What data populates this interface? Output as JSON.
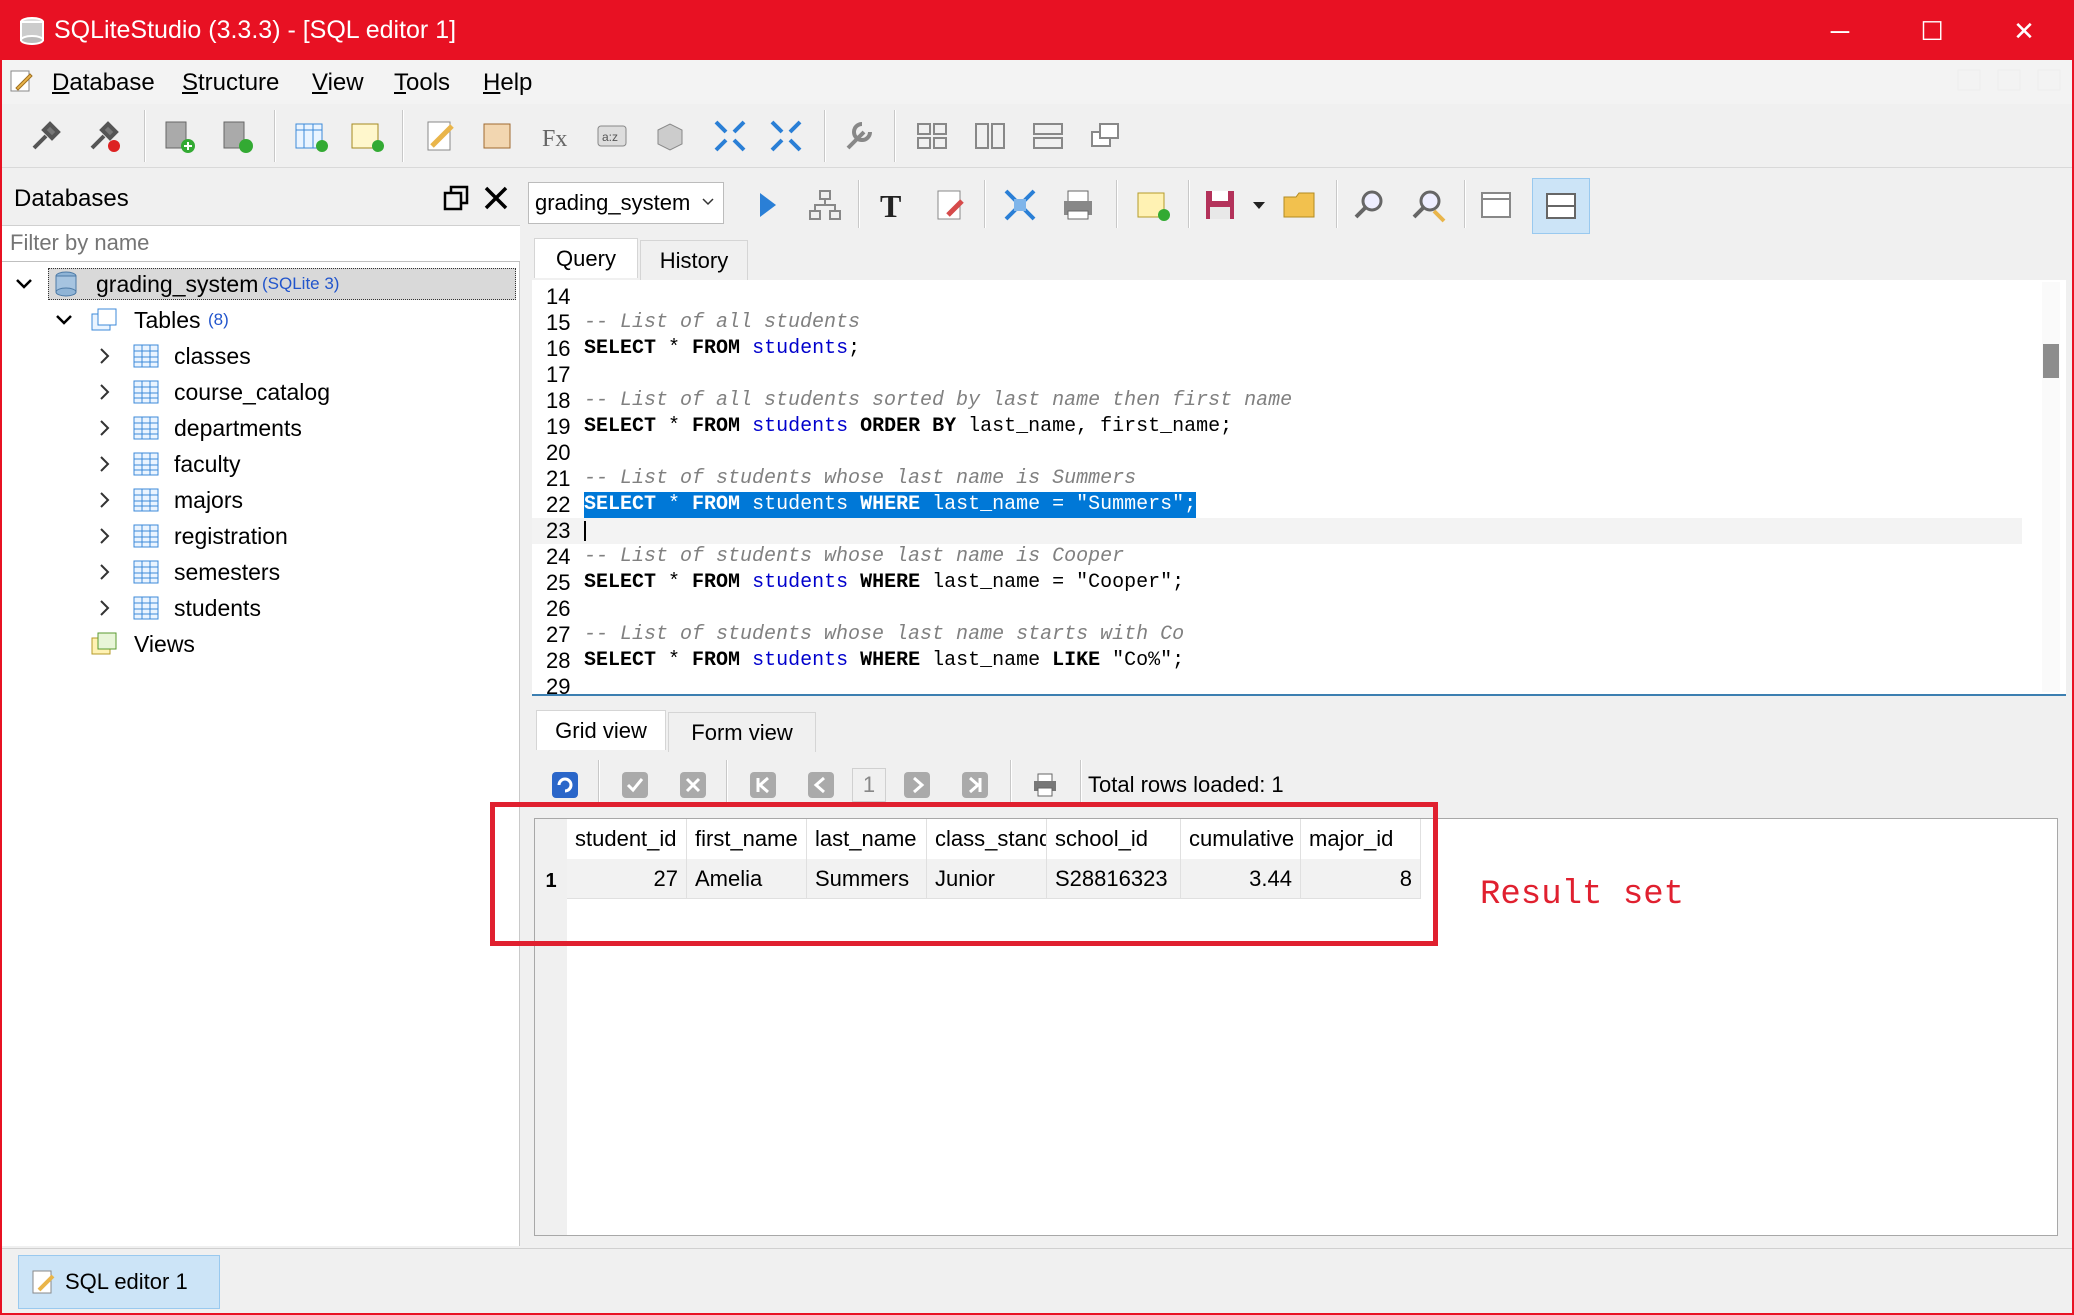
{
  "window": {
    "title": "SQLiteStudio (3.3.3) - [SQL editor 1]",
    "minimize": "─",
    "maximize": "☐",
    "close": "✕"
  },
  "menu": [
    "Database",
    "Structure",
    "View",
    "Tools",
    "Help"
  ],
  "databases_panel": {
    "title": "Databases",
    "filter_placeholder": "Filter by name",
    "db_name": "grading_system",
    "db_type": "(SQLite 3)",
    "tables_label": "Tables",
    "tables_count": "(8)",
    "tables": [
      "classes",
      "course_catalog",
      "departments",
      "faculty",
      "majors",
      "registration",
      "semesters",
      "students"
    ],
    "views_label": "Views"
  },
  "editor": {
    "db_selected": "grading_system",
    "tabs": [
      "Query",
      "History"
    ],
    "lines": [
      {
        "n": "14",
        "parts": []
      },
      {
        "n": "15",
        "parts": [
          {
            "t": "cmt",
            "v": "-- List of all students"
          }
        ]
      },
      {
        "n": "16",
        "parts": [
          {
            "t": "kw",
            "v": "SELECT"
          },
          {
            "t": "",
            "v": " * "
          },
          {
            "t": "kw",
            "v": "FROM"
          },
          {
            "t": "",
            "v": " "
          },
          {
            "t": "tbl",
            "v": "students"
          },
          {
            "t": "",
            "v": ";"
          }
        ]
      },
      {
        "n": "17",
        "parts": []
      },
      {
        "n": "18",
        "parts": [
          {
            "t": "cmt",
            "v": "-- List of all students sorted by last name then first name"
          }
        ]
      },
      {
        "n": "19",
        "parts": [
          {
            "t": "kw",
            "v": "SELECT"
          },
          {
            "t": "",
            "v": " * "
          },
          {
            "t": "kw",
            "v": "FROM"
          },
          {
            "t": "",
            "v": " "
          },
          {
            "t": "tbl",
            "v": "students"
          },
          {
            "t": "",
            "v": " "
          },
          {
            "t": "kw",
            "v": "ORDER BY"
          },
          {
            "t": "",
            "v": " last_name, first_name;"
          }
        ]
      },
      {
        "n": "20",
        "parts": []
      },
      {
        "n": "21",
        "parts": [
          {
            "t": "cmt",
            "v": "-- List of students whose last name is Summers"
          }
        ]
      },
      {
        "n": "22",
        "highlight": true,
        "parts": [
          {
            "t": "kw",
            "v": "SELECT"
          },
          {
            "t": "",
            "v": " * "
          },
          {
            "t": "kw",
            "v": "FROM"
          },
          {
            "t": "",
            "v": " "
          },
          {
            "t": "tbl",
            "v": "students"
          },
          {
            "t": "",
            "v": " "
          },
          {
            "t": "kw",
            "v": "WHERE"
          },
          {
            "t": "",
            "v": " last_name = \"Summers\";"
          }
        ]
      },
      {
        "n": "23",
        "current": true,
        "parts": []
      },
      {
        "n": "24",
        "parts": [
          {
            "t": "cmt",
            "v": "-- List of students whose last name is Cooper"
          }
        ]
      },
      {
        "n": "25",
        "parts": [
          {
            "t": "kw",
            "v": "SELECT"
          },
          {
            "t": "",
            "v": " * "
          },
          {
            "t": "kw",
            "v": "FROM"
          },
          {
            "t": "",
            "v": " "
          },
          {
            "t": "tbl",
            "v": "students"
          },
          {
            "t": "",
            "v": " "
          },
          {
            "t": "kw",
            "v": "WHERE"
          },
          {
            "t": "",
            "v": " last_name = \"Cooper\";"
          }
        ]
      },
      {
        "n": "26",
        "parts": []
      },
      {
        "n": "27",
        "parts": [
          {
            "t": "cmt",
            "v": "-- List of students whose last name starts with Co"
          }
        ]
      },
      {
        "n": "28",
        "parts": [
          {
            "t": "kw",
            "v": "SELECT"
          },
          {
            "t": "",
            "v": " * "
          },
          {
            "t": "kw",
            "v": "FROM"
          },
          {
            "t": "",
            "v": " "
          },
          {
            "t": "tbl",
            "v": "students"
          },
          {
            "t": "",
            "v": " "
          },
          {
            "t": "kw",
            "v": "WHERE"
          },
          {
            "t": "",
            "v": " last_name "
          },
          {
            "t": "kw",
            "v": "LIKE"
          },
          {
            "t": "",
            "v": " \"Co%\";"
          }
        ]
      },
      {
        "n": "29",
        "parts": []
      }
    ]
  },
  "results": {
    "tabs": [
      "Grid view",
      "Form view"
    ],
    "page": "1",
    "total_rows": "Total rows loaded: 1",
    "columns": [
      "student_id",
      "first_name",
      "last_name",
      "class_standing",
      "school_id",
      "cumulative",
      "major_id"
    ],
    "rows": [
      {
        "row": "1",
        "cells": [
          "27",
          "Amelia",
          "Summers",
          "Junior",
          "S28816323",
          "3.44",
          "8"
        ]
      }
    ]
  },
  "annotation": "Result set",
  "statusbar": {
    "task": "SQL editor 1"
  },
  "colors": {
    "titlebar": "#e81123",
    "selection": "#0078d7",
    "annotation": "#e0202f"
  }
}
